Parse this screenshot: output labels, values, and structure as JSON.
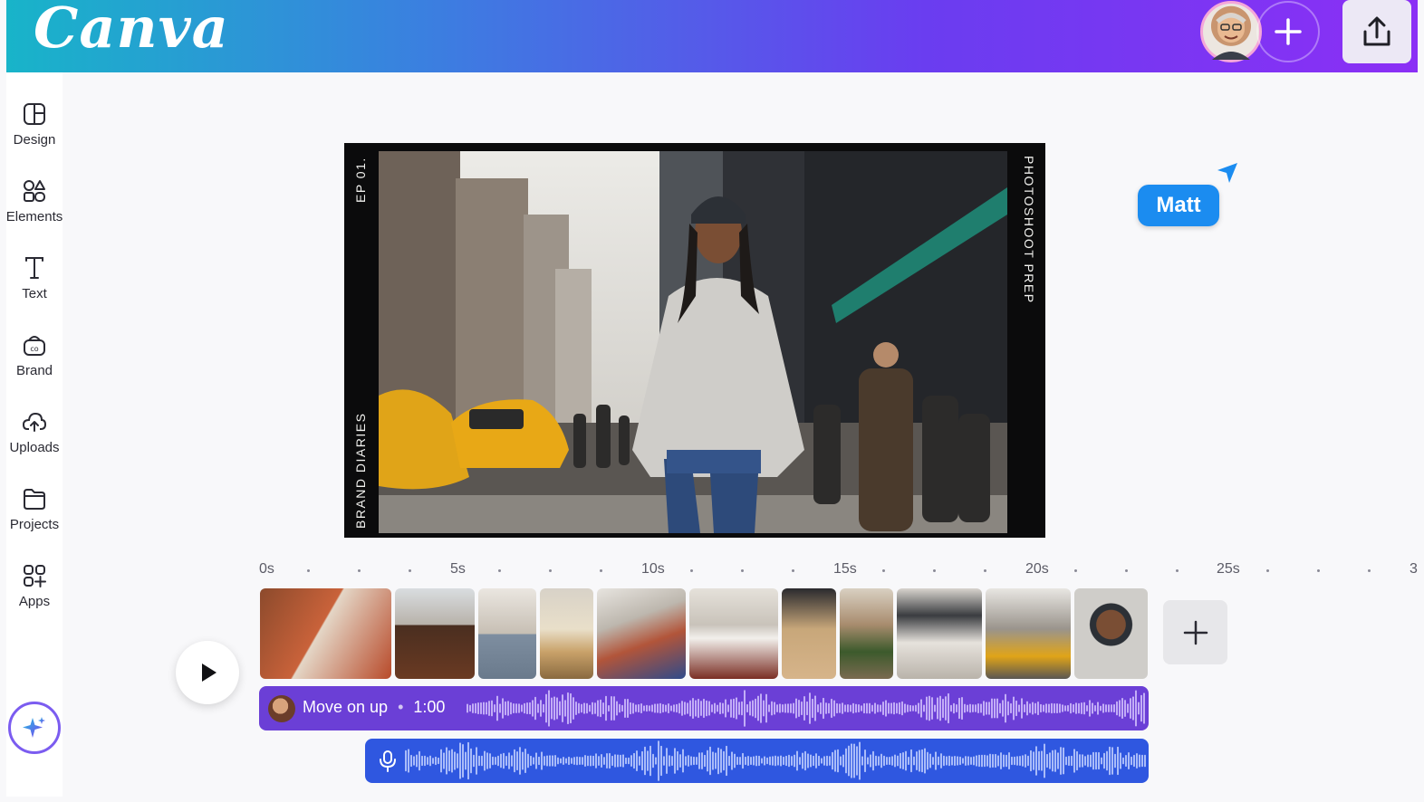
{
  "header": {
    "logo": "Canva",
    "accent_gradient": [
      "#18b4c9",
      "#3b7fe0",
      "#6a3df0",
      "#8b2ff5"
    ],
    "invite_icon": "plus-icon",
    "share_icon": "upload-share-icon"
  },
  "sidebar": {
    "items": [
      {
        "label": "Design",
        "icon": "design-layout-icon"
      },
      {
        "label": "Elements",
        "icon": "elements-shapes-icon"
      },
      {
        "label": "Text",
        "icon": "text-t-icon"
      },
      {
        "label": "Brand",
        "icon": "brand-kit-icon"
      },
      {
        "label": "Uploads",
        "icon": "cloud-upload-icon"
      },
      {
        "label": "Projects",
        "icon": "folder-icon"
      },
      {
        "label": "Apps",
        "icon": "apps-grid-icon"
      }
    ],
    "magic_icon": "sparkle-icon"
  },
  "canvas": {
    "left_top_text": "EP 01.",
    "left_bottom_text": "BRAND DIARIES",
    "right_text": "PHOTOSHOOT PREP"
  },
  "collaborator": {
    "name": "Matt",
    "color": "#1b8cf0"
  },
  "timeline": {
    "ruler_labels": [
      "0s",
      "5s",
      "10s",
      "15s",
      "20s",
      "25s",
      "3"
    ],
    "clip_count": 11,
    "music_track": {
      "title": "Move on up",
      "separator": "•",
      "duration": "1:00",
      "color": "#6b3fd6"
    },
    "voice_track": {
      "icon": "microphone-icon",
      "color": "#2f57e0"
    }
  }
}
